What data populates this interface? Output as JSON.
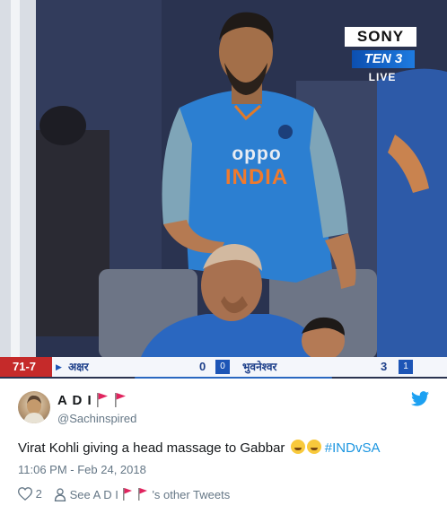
{
  "broadcast": {
    "network_logo": "SONY",
    "channel_logo": "TEN 3",
    "live_label": "LIVE",
    "jersey_brand": "oppo",
    "jersey_country": "INDIA"
  },
  "scorebar": {
    "score": "71-7",
    "batsman1_name": "अक्षर",
    "batsman1_runs": "0",
    "batsman1_balls": "0",
    "batsman2_name": "भुवनेश्वर",
    "batsman2_runs": "3",
    "batsman2_balls": "1"
  },
  "tweet": {
    "author_name": "A D I",
    "handle": "@Sachinspired",
    "text_main": "Virat Kohli giving a head massage to Gabbar",
    "emoji_name": "face-with-tears-of-joy",
    "hashtag": "#INDvSA",
    "timestamp": "11:06 PM - Feb 24, 2018",
    "like_count": "2",
    "profile_link_prefix": "See A D I",
    "profile_link_suffix": "'s other Tweets",
    "icons": [
      "heart-icon",
      "person-icon",
      "twitter-bird-icon",
      "red-flag-icon"
    ]
  },
  "colors": {
    "hashtag": "#1b95e0",
    "twitter_blue": "#1da1f2",
    "flag_red": "#e0245e",
    "secondary_text": "#657786"
  }
}
